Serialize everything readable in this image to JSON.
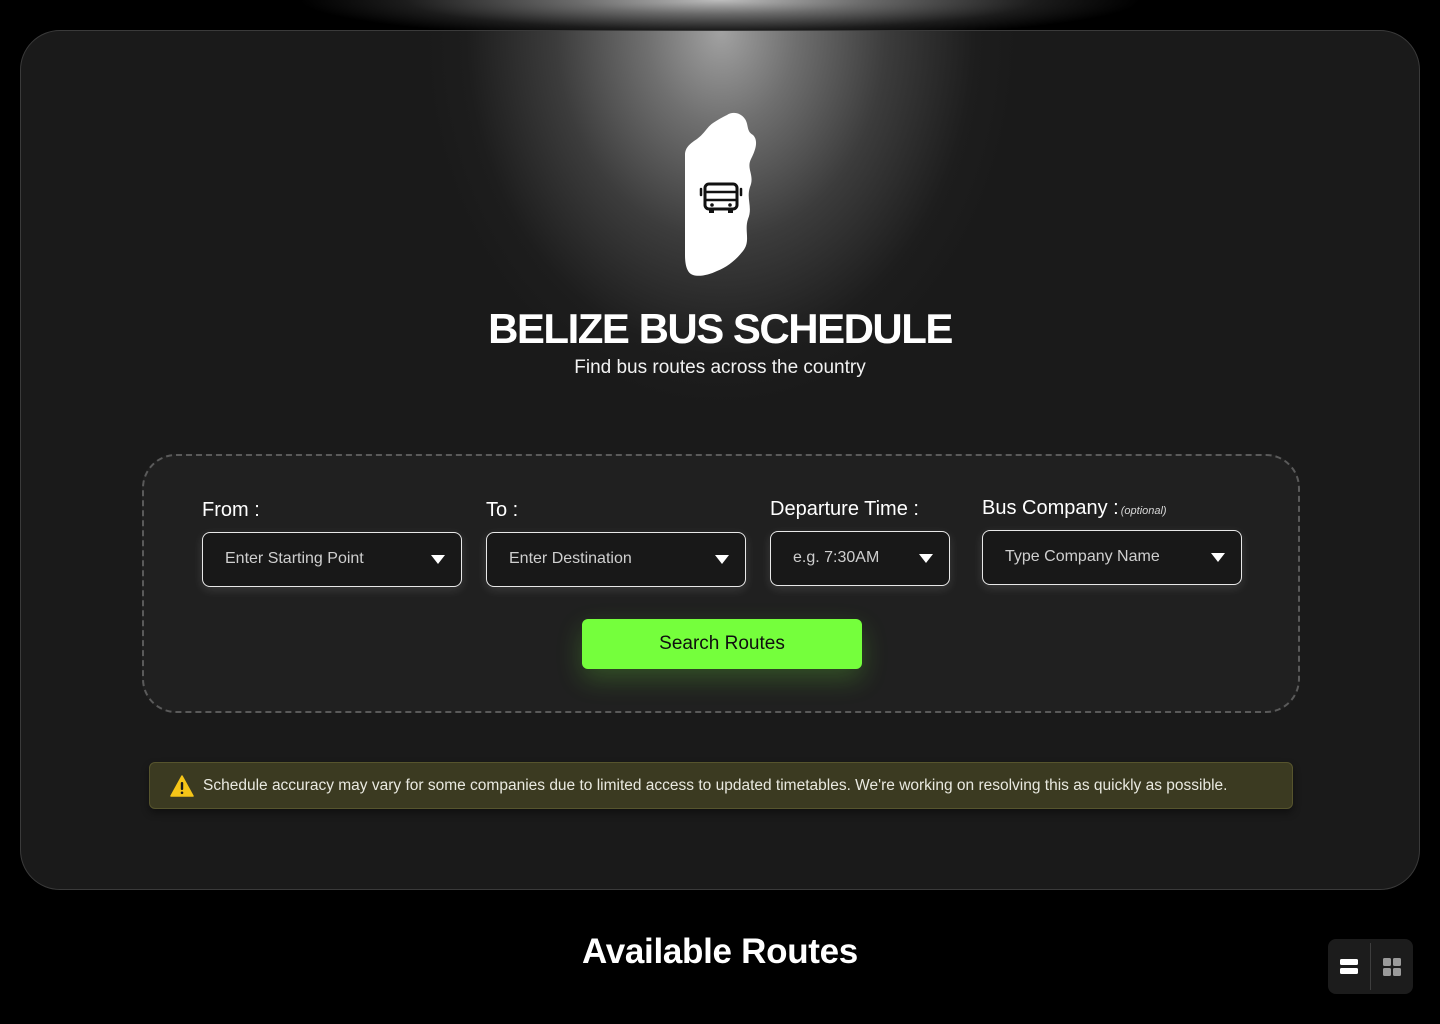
{
  "header": {
    "title": "BELIZE BUS SCHEDULE",
    "subtitle": "Find bus routes across the country",
    "logo_icon": "belize-map-with-bus-icon"
  },
  "search_form": {
    "from": {
      "label": "From :",
      "placeholder": "Enter Starting Point"
    },
    "to": {
      "label": "To :",
      "placeholder": "Enter Destination"
    },
    "departure": {
      "label": "Departure Time :",
      "placeholder": "e.g. 7:30AM"
    },
    "company": {
      "label": "Bus Company :",
      "optional": "(optional)",
      "placeholder": "Type Company Name"
    },
    "submit_label": "Search Routes"
  },
  "notice": {
    "icon": "warning-icon",
    "text": "Schedule accuracy may vary for some companies due to limited access to updated timetables. We're working on resolving this as quickly as possible."
  },
  "results": {
    "title": "Available Routes",
    "view_options": [
      "list-view-icon",
      "grid-view-icon"
    ]
  },
  "colors": {
    "accent": "#75ff3c",
    "background": "#000000",
    "card": "#1a1a1a",
    "notice_bg": "#3b3a21",
    "warning": "#f5c518"
  }
}
